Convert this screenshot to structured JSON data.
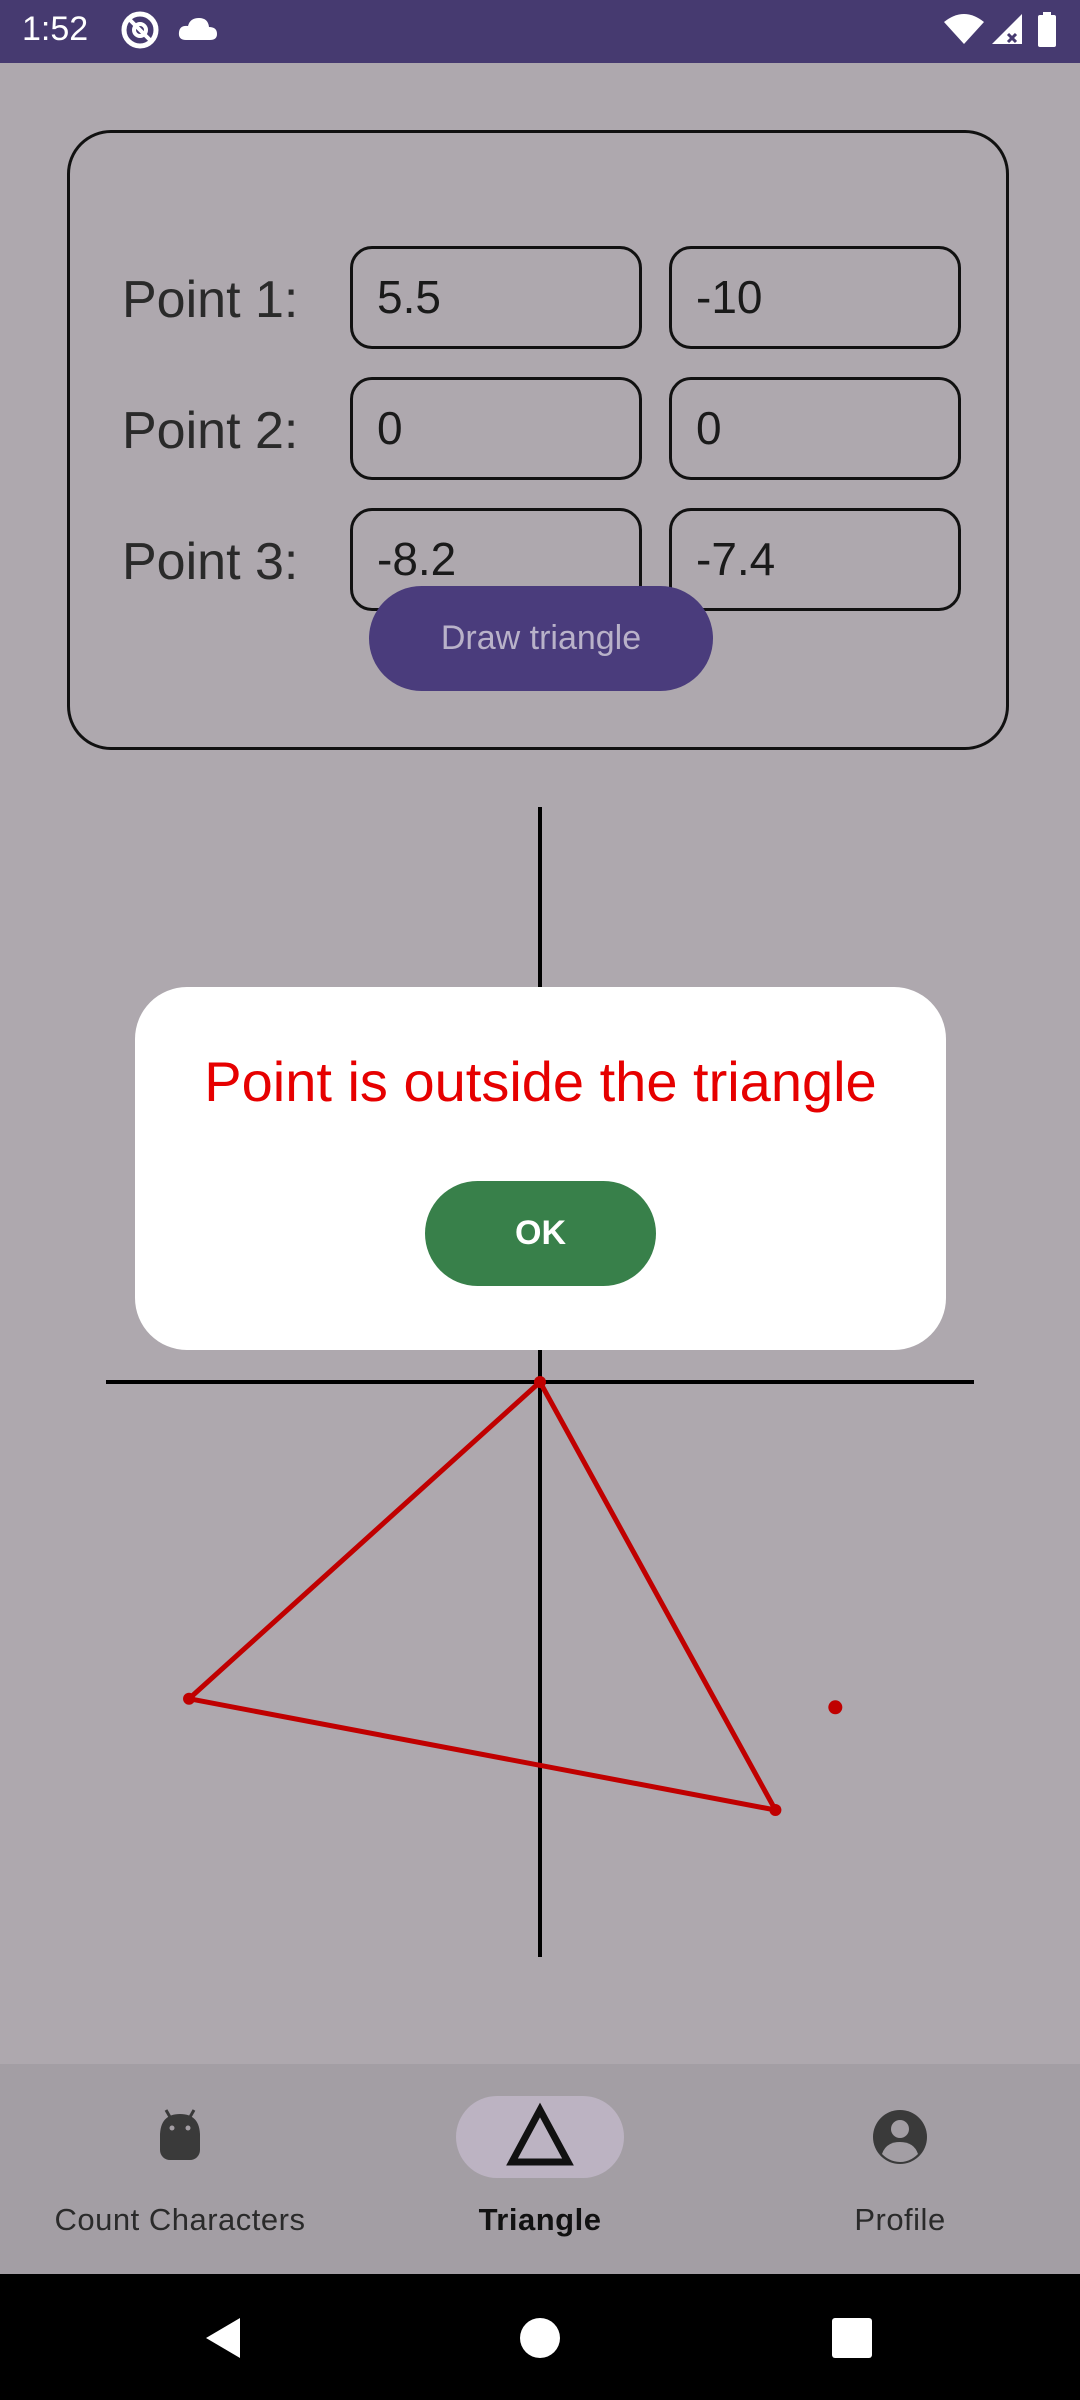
{
  "status_bar": {
    "time": "1:52",
    "left_icons": [
      "at-sign-icon",
      "cloud-icon"
    ],
    "right_icons": [
      "wifi-icon",
      "signal-icon",
      "battery-icon"
    ]
  },
  "form": {
    "points": [
      {
        "label": "Point 1:",
        "x": "5.5",
        "y": "-10"
      },
      {
        "label": "Point 2:",
        "x": "0",
        "y": "0"
      },
      {
        "label": "Point 3:",
        "x": "-8.2",
        "y": "-7.4"
      }
    ],
    "draw_button_label": "Draw triangle"
  },
  "plot": {
    "triangle_vertices": [
      [
        5.5,
        -10
      ],
      [
        0,
        0
      ],
      [
        -8.2,
        -7.4
      ]
    ],
    "test_point": [
      6.9,
      -7.6
    ],
    "line_color": "#c00000"
  },
  "dialog": {
    "message": "Point is outside the triangle",
    "ok_label": "OK",
    "message_color": "#e60000",
    "ok_color": "#38804a"
  },
  "bottom_nav": {
    "items": [
      {
        "label": "Count Characters",
        "icon": "android-icon",
        "active": false
      },
      {
        "label": "Triangle",
        "icon": "triangle-icon",
        "active": true
      },
      {
        "label": "Profile",
        "icon": "account-circle-icon",
        "active": false
      }
    ]
  },
  "system_nav": {
    "icons": [
      "back-icon",
      "home-icon",
      "recents-icon"
    ]
  }
}
